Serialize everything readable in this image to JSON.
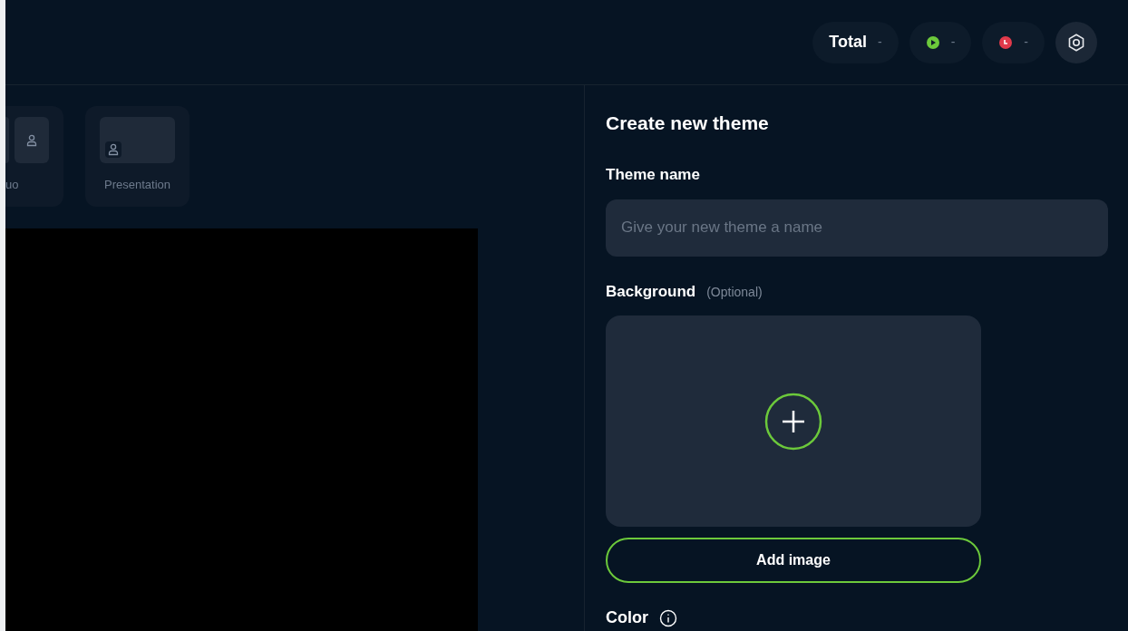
{
  "top_bar": {
    "stats": [
      {
        "kind": "total",
        "label": "Total",
        "value": "-"
      },
      {
        "kind": "live",
        "value": "-"
      },
      {
        "kind": "recording",
        "value": "-"
      }
    ]
  },
  "layouts": [
    {
      "kind": "duo",
      "label": "uo"
    },
    {
      "kind": "presentation",
      "label": "Presentation"
    }
  ],
  "theme_panel": {
    "title": "Create new theme",
    "name_label": "Theme name",
    "name_field": {
      "placeholder": "Give your new theme a name"
    },
    "background_label": "Background",
    "background_hint": "(Optional)",
    "add_image": "Add image",
    "color_label": "Color"
  }
}
